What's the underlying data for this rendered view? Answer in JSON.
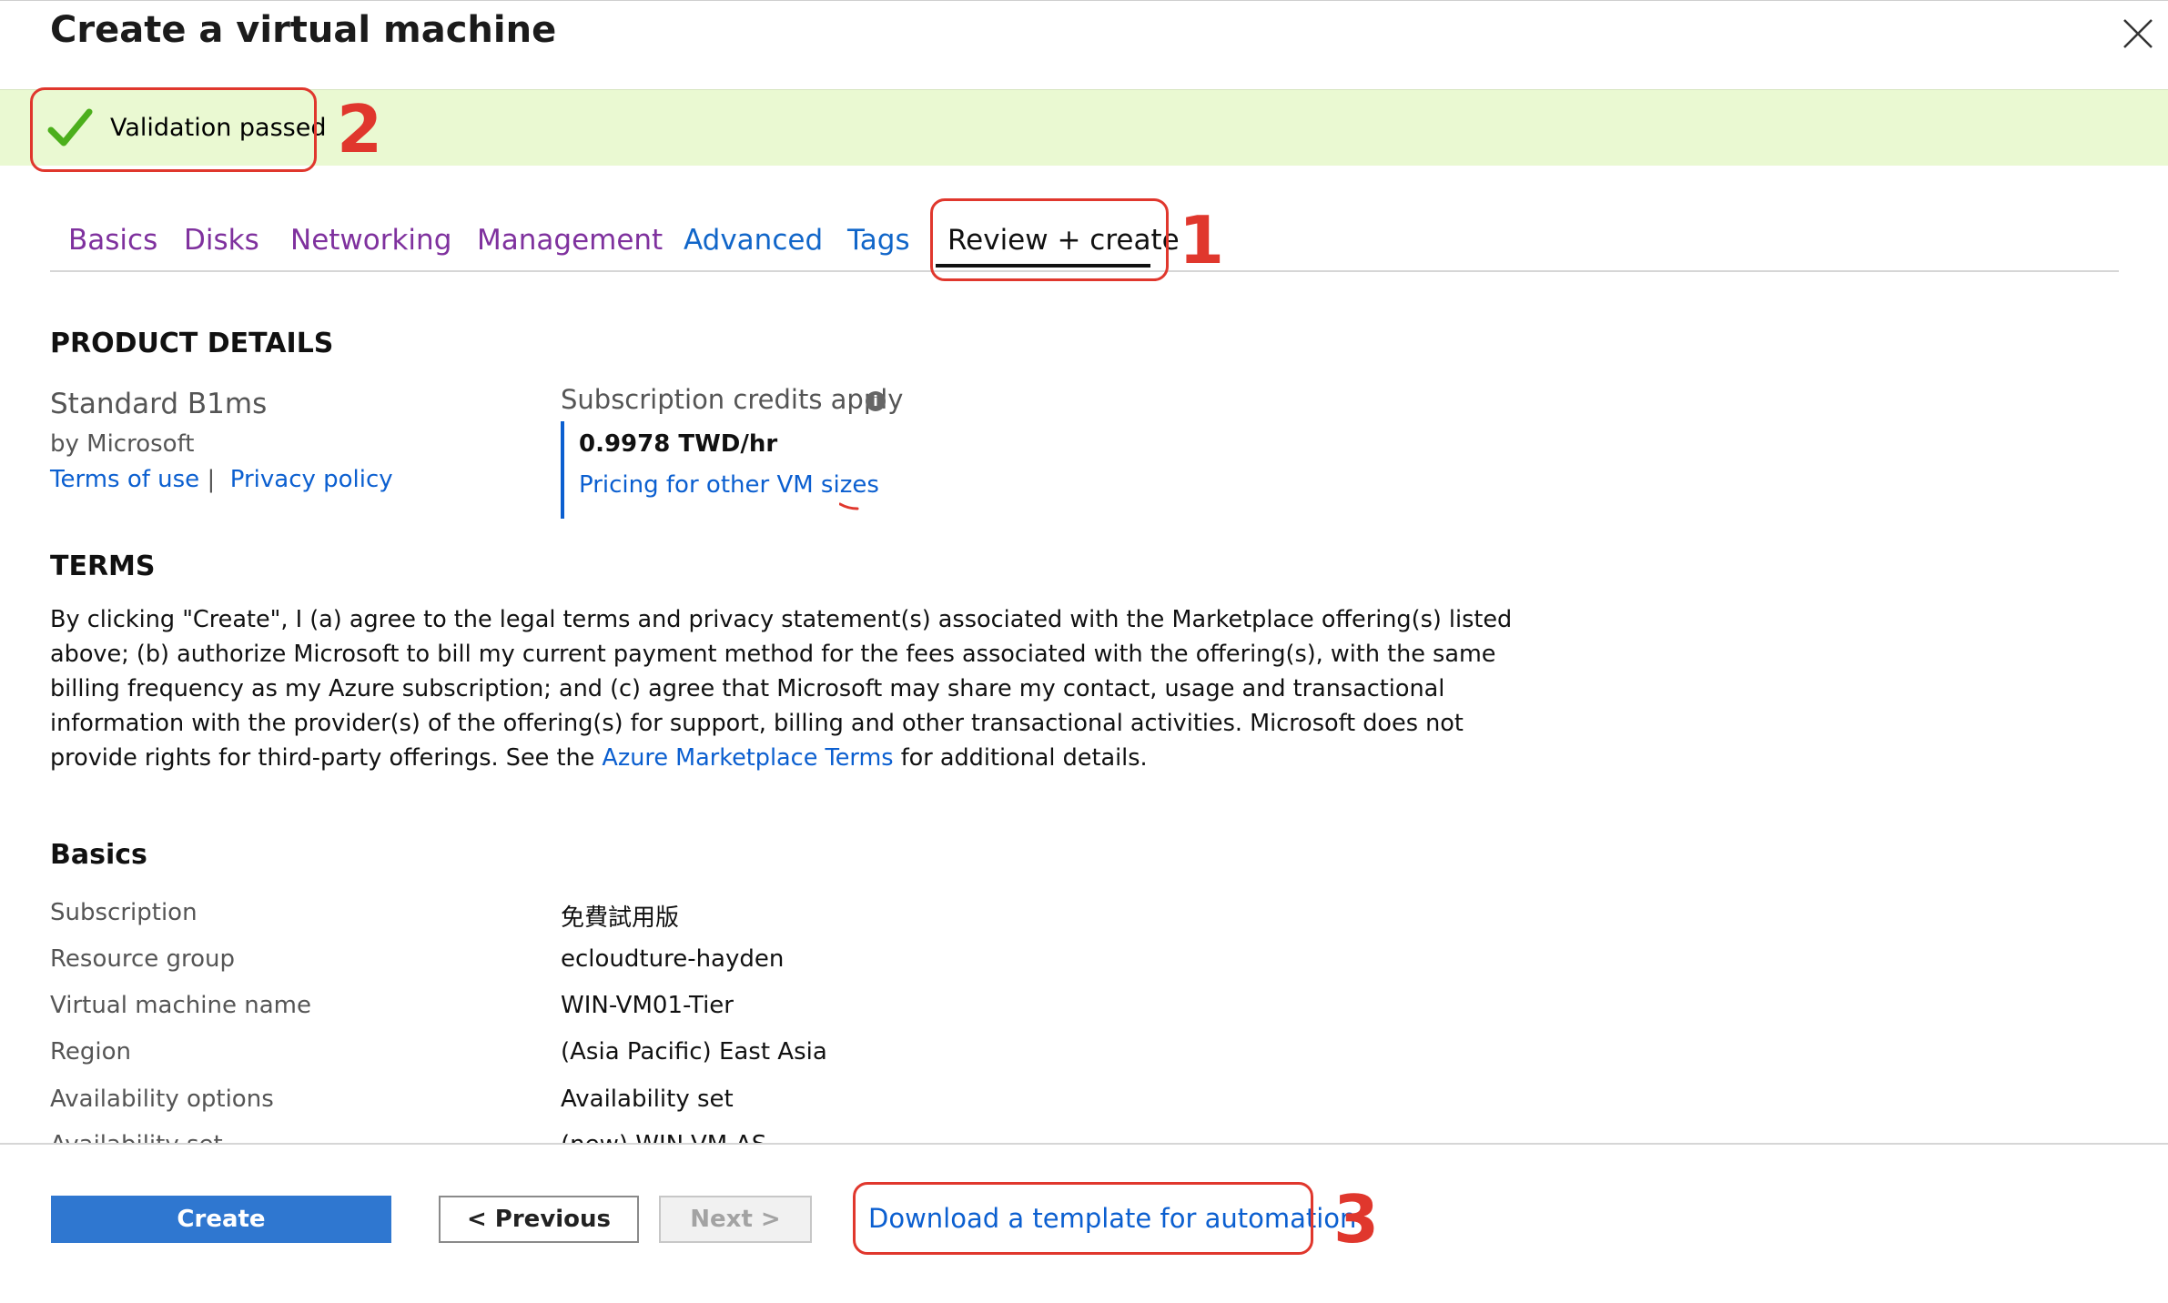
{
  "window": {
    "title": "Create a virtual machine",
    "close_icon": "close-icon"
  },
  "banner": {
    "status_text": "Validation passed",
    "status_icon": "checkmark-icon",
    "status_color": "#4caf1c",
    "background_color": "#eaf9d2"
  },
  "tabs": [
    {
      "label": "Basics"
    },
    {
      "label": "Disks"
    },
    {
      "label": "Networking"
    },
    {
      "label": "Management"
    },
    {
      "label": "Advanced"
    },
    {
      "label": "Tags"
    },
    {
      "label": "Review + create",
      "active": true
    }
  ],
  "annotations": {
    "one": "1",
    "two": "2",
    "three": "3",
    "color": "#e0372d"
  },
  "product": {
    "heading": "PRODUCT DETAILS",
    "name": "Standard B1ms",
    "publisher": "by Microsoft",
    "terms_link": "Terms of use",
    "separator": "|",
    "privacy_link": "Privacy policy",
    "credits_label": "Subscription credits apply",
    "info_icon": "info-icon",
    "price": "0.9978 TWD/hr",
    "pricing_link": "Pricing for other VM sizes"
  },
  "terms": {
    "heading": "TERMS",
    "body": "By clicking \"Create\", I (a) agree to the legal terms and privacy statement(s) associated with the Marketplace offering(s) listed above; (b) authorize Microsoft to bill my current payment method for the fees associated with the offering(s), with the same billing frequency as my Azure subscription; and (c) agree that Microsoft may share my contact, usage and transactional information with the provider(s) of the offering(s) for support, billing and other transactional activities. Microsoft does not provide rights for third-party offerings. See the",
    "marketplace_link": "Azure Marketplace Terms",
    "tail": "for additional details."
  },
  "basics": {
    "heading": "Basics",
    "rows": [
      {
        "label": "Subscription",
        "value": "免費試用版"
      },
      {
        "label": "Resource group",
        "value": "ecloudture-hayden"
      },
      {
        "label": "Virtual machine name",
        "value": "WIN-VM01-Tier"
      },
      {
        "label": "Region",
        "value": "(Asia Pacific) East Asia"
      },
      {
        "label": "Availability options",
        "value": "Availability set"
      },
      {
        "label": "Availability set",
        "value": "(new) WIN-VM-AS"
      }
    ]
  },
  "footer": {
    "create_label": "Create",
    "previous_label": "< Previous",
    "next_label": "Next >",
    "download_link": "Download a template for automation",
    "primary_color": "#2f77d0"
  }
}
